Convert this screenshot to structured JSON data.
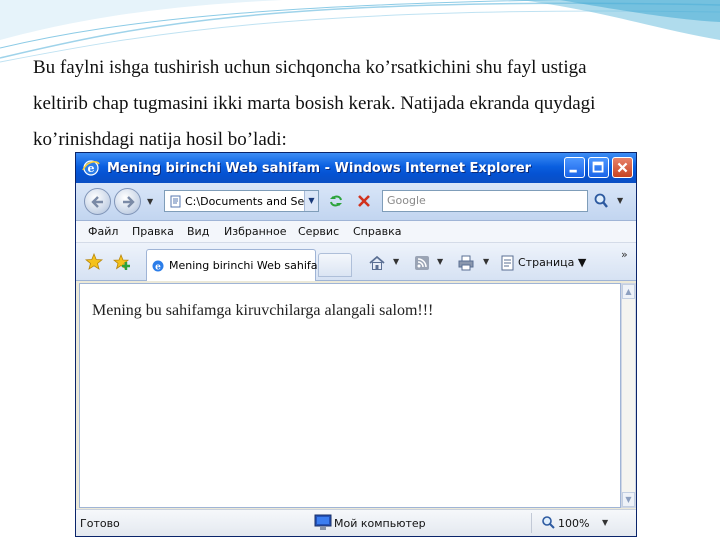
{
  "paragraph": {
    "line1": "Bu faylni ishga tushirish uchun sichqoncha ko’rsatkichini shu fayl ustiga",
    "line2": "keltirib chap tugmasini ikki marta bosish kerak. Natijada ekranda quydagi",
    "line3": "ko’rinishdagi natija hosil bo’ladi:"
  },
  "browser": {
    "window_title": "Mening birinchi Web sahifam - Windows Internet Explorer",
    "address": "C:\\Documents and Se",
    "search_placeholder": "Google",
    "menu": [
      "Файл",
      "Правка",
      "Вид",
      "Избранное",
      "Сервис",
      "Справка"
    ],
    "tab_title": "Mening birinchi Web sahifam",
    "page_menu": "Страница",
    "overflow": "»",
    "page_content": "Mening bu sahifamga kiruvchilarga alangali salom!!!",
    "status": "Готово",
    "zone": "Мой компьютер",
    "zoom": "100%"
  },
  "icons": {
    "back": "back-arrow-icon",
    "forward": "forward-arrow-icon",
    "refresh": "refresh-icon",
    "stop": "stop-icon",
    "search": "magnifier-icon",
    "favorites": "star-icon",
    "add_favorite": "add-favorite-icon",
    "home": "home-icon",
    "feeds": "rss-icon",
    "print": "printer-icon",
    "page": "page-icon",
    "computer": "computer-icon",
    "zoom": "zoom-icon"
  },
  "colors": {
    "titlebar": "#0a5fe0",
    "close_button": "#c64322",
    "toolbar": "#c2d5f0"
  }
}
